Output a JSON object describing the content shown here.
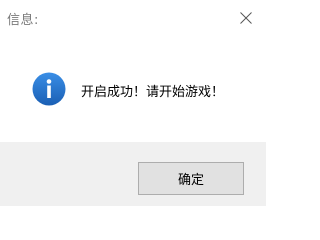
{
  "dialog": {
    "title": "信息:",
    "message": "开启成功！请开始游戏！",
    "ok_label": "确定",
    "icon": "info-icon",
    "close_icon": "close-icon"
  },
  "colors": {
    "icon_blue": "#1f6fd0",
    "footer_bg": "#f0f0f0",
    "button_bg": "#e1e1e1",
    "button_border": "#adadad"
  }
}
